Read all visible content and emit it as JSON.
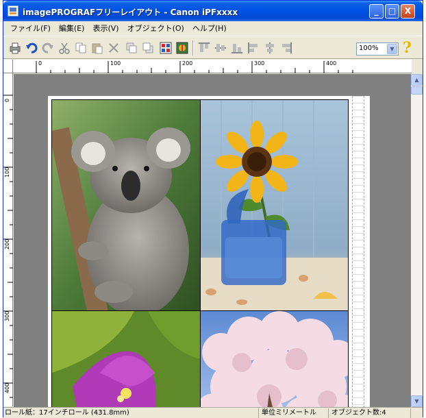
{
  "window": {
    "title": "imagePROGRAFフリーレイアウト - Canon iPFxxxx",
    "minimize_label": "_",
    "maximize_label": "□",
    "close_label": "X"
  },
  "menubar": {
    "items": [
      "ファイル(F)",
      "編集(E)",
      "表示(V)",
      "オブジェクト(O)",
      "ヘルプ(H)"
    ]
  },
  "toolbar": {
    "icons": [
      "print-icon",
      "undo-icon",
      "redo-icon",
      "cut-icon",
      "copy-icon",
      "paste-icon",
      "delete-icon",
      "front-icon",
      "back-icon",
      "grid-layout-icon",
      "image-adjust-icon",
      "align-top-icon",
      "align-center-vertical-icon",
      "align-bottom-icon",
      "align-left-icon",
      "align-center-horizontal-icon",
      "align-right-icon"
    ],
    "zoom": "100%",
    "help_label": "?"
  },
  "ruler": {
    "top_labels": [
      "0",
      "100",
      "200",
      "300",
      "400"
    ],
    "left_labels": [
      "0",
      "100",
      "200",
      "300",
      "400"
    ]
  },
  "canvas": {
    "photos": [
      "koala-photo",
      "sunflower-photo",
      "bougainvillea-photo",
      "cherry-blossom-photo"
    ]
  },
  "statusbar": {
    "paper": "ロール紙：17インチロール (431.8mm)",
    "unit": "単位ミリメートル",
    "objects": "オブジェクト数:4"
  },
  "colors": {
    "titlebar": "#0054e3",
    "chrome": "#ece9d8",
    "canvas": "#808080"
  }
}
